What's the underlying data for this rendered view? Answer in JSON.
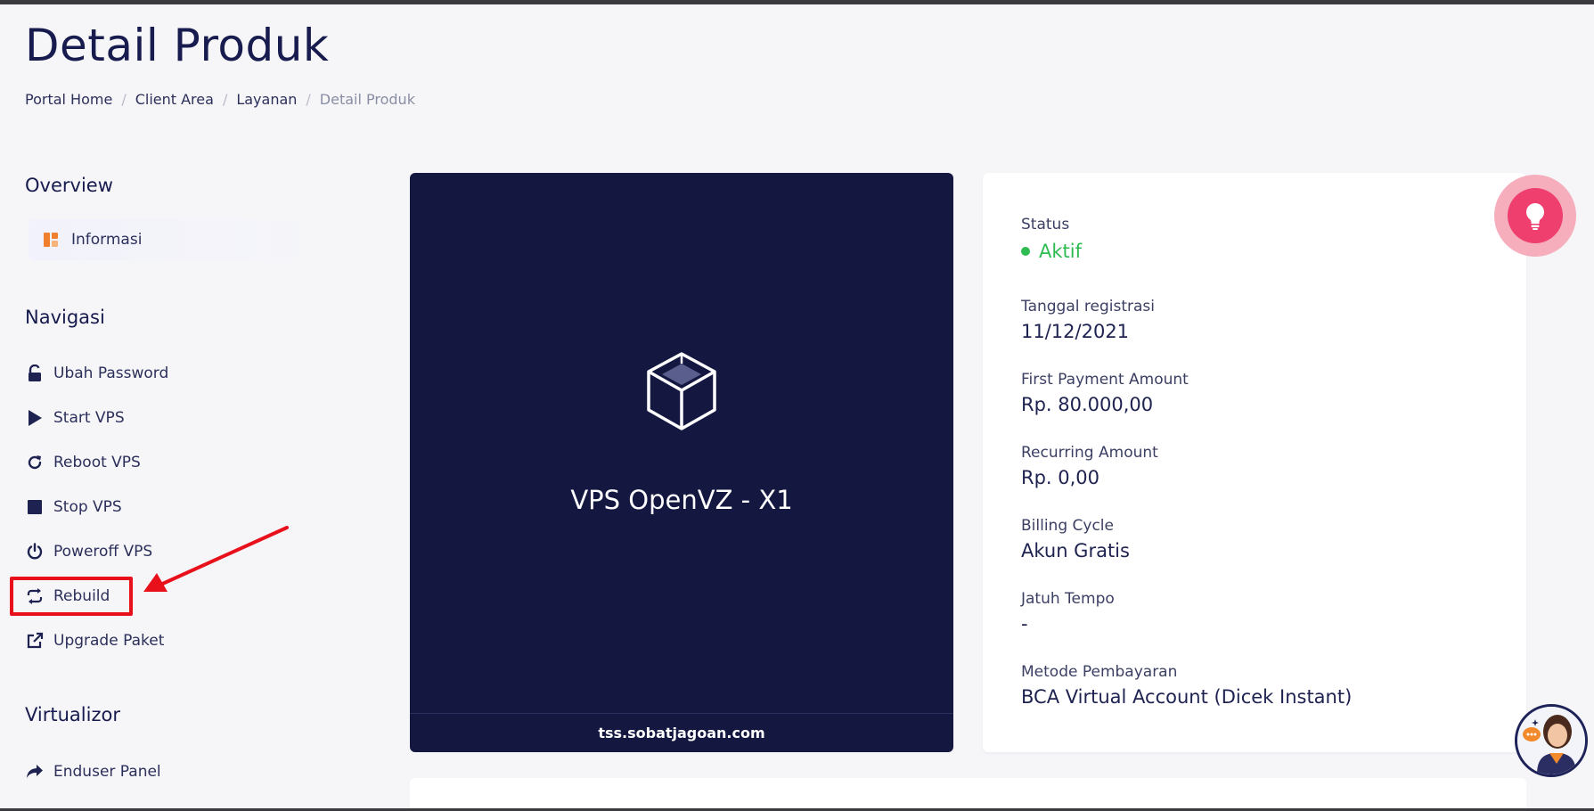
{
  "page": {
    "title": "Detail Produk"
  },
  "breadcrumb": [
    {
      "label": "Portal Home"
    },
    {
      "label": "Client Area"
    },
    {
      "label": "Layanan"
    },
    {
      "label": "Detail Produk"
    }
  ],
  "sidebar": {
    "overview_heading": "Overview",
    "overview_items": [
      {
        "label": "Informasi",
        "icon": "dashboard-icon"
      }
    ],
    "nav_heading": "Navigasi",
    "nav_items": [
      {
        "label": "Ubah Password",
        "icon": "lock-icon"
      },
      {
        "label": "Start VPS",
        "icon": "play-icon"
      },
      {
        "label": "Reboot VPS",
        "icon": "refresh-icon"
      },
      {
        "label": "Stop VPS",
        "icon": "stop-icon"
      },
      {
        "label": "Poweroff VPS",
        "icon": "power-icon"
      },
      {
        "label": "Rebuild",
        "icon": "rebuild-icon"
      },
      {
        "label": "Upgrade Paket",
        "icon": "external-link-icon"
      }
    ],
    "virt_heading": "Virtualizor",
    "virt_items": [
      {
        "label": "Enduser Panel",
        "icon": "share-icon"
      }
    ]
  },
  "product": {
    "name": "VPS OpenVZ - X1",
    "domain": "tss.sobatjagoan.com",
    "icon": "cube-icon"
  },
  "details": {
    "status_label": "Status",
    "status_value": "Aktif",
    "reg_date_label": "Tanggal registrasi",
    "reg_date_value": "11/12/2021",
    "first_payment_label": "First Payment Amount",
    "first_payment_value": "Rp. 80.000,00",
    "recurring_label": "Recurring Amount",
    "recurring_value": "Rp. 0,00",
    "billing_cycle_label": "Billing Cycle",
    "billing_cycle_value": "Akun Gratis",
    "due_date_label": "Jatuh Tempo",
    "due_date_value": "-",
    "payment_method_label": "Metode Pembayaran",
    "payment_method_value": "BCA Virtual Account (Dicek Instant)"
  },
  "colors": {
    "accent": "#141841",
    "status_active": "#2dbb52",
    "highlight": "#e8101b",
    "tip": "#ee3f6e",
    "informasi_icon": "#f07f2e"
  }
}
